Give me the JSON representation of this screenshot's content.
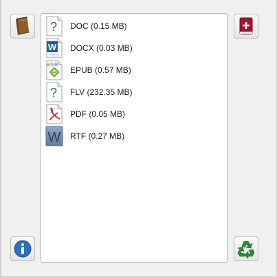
{
  "buttons": {
    "top_left": {
      "icon": "book-icon"
    },
    "top_right": {
      "icon": "add-book-icon"
    },
    "bottom_left": {
      "icon": "info-icon"
    },
    "bottom_right": {
      "icon": "recycle-icon"
    }
  },
  "formats": [
    {
      "label": "DOC (0.15 MB)",
      "icon": "question-file-icon"
    },
    {
      "label": "DOCX (0.03 MB)",
      "icon": "word-file-icon"
    },
    {
      "label": "EPUB (0.57 MB)",
      "icon": "epub-file-icon",
      "icon_text": "ePUB"
    },
    {
      "label": "FLV (232.35 MB)",
      "icon": "question-file-icon"
    },
    {
      "label": "PDF (0.05 MB)",
      "icon": "pdf-file-icon"
    },
    {
      "label": "RTF (0.27 MB)",
      "icon": "rtf-file-icon"
    }
  ],
  "colors": {
    "epub_green": "#7ab43a",
    "pdf_red": "#c42a2a",
    "word_blue": "#2a5aa6",
    "book_red": "#a3152c",
    "info_blue": "#2b6fc2",
    "recycle_green": "#2e8b2e"
  }
}
